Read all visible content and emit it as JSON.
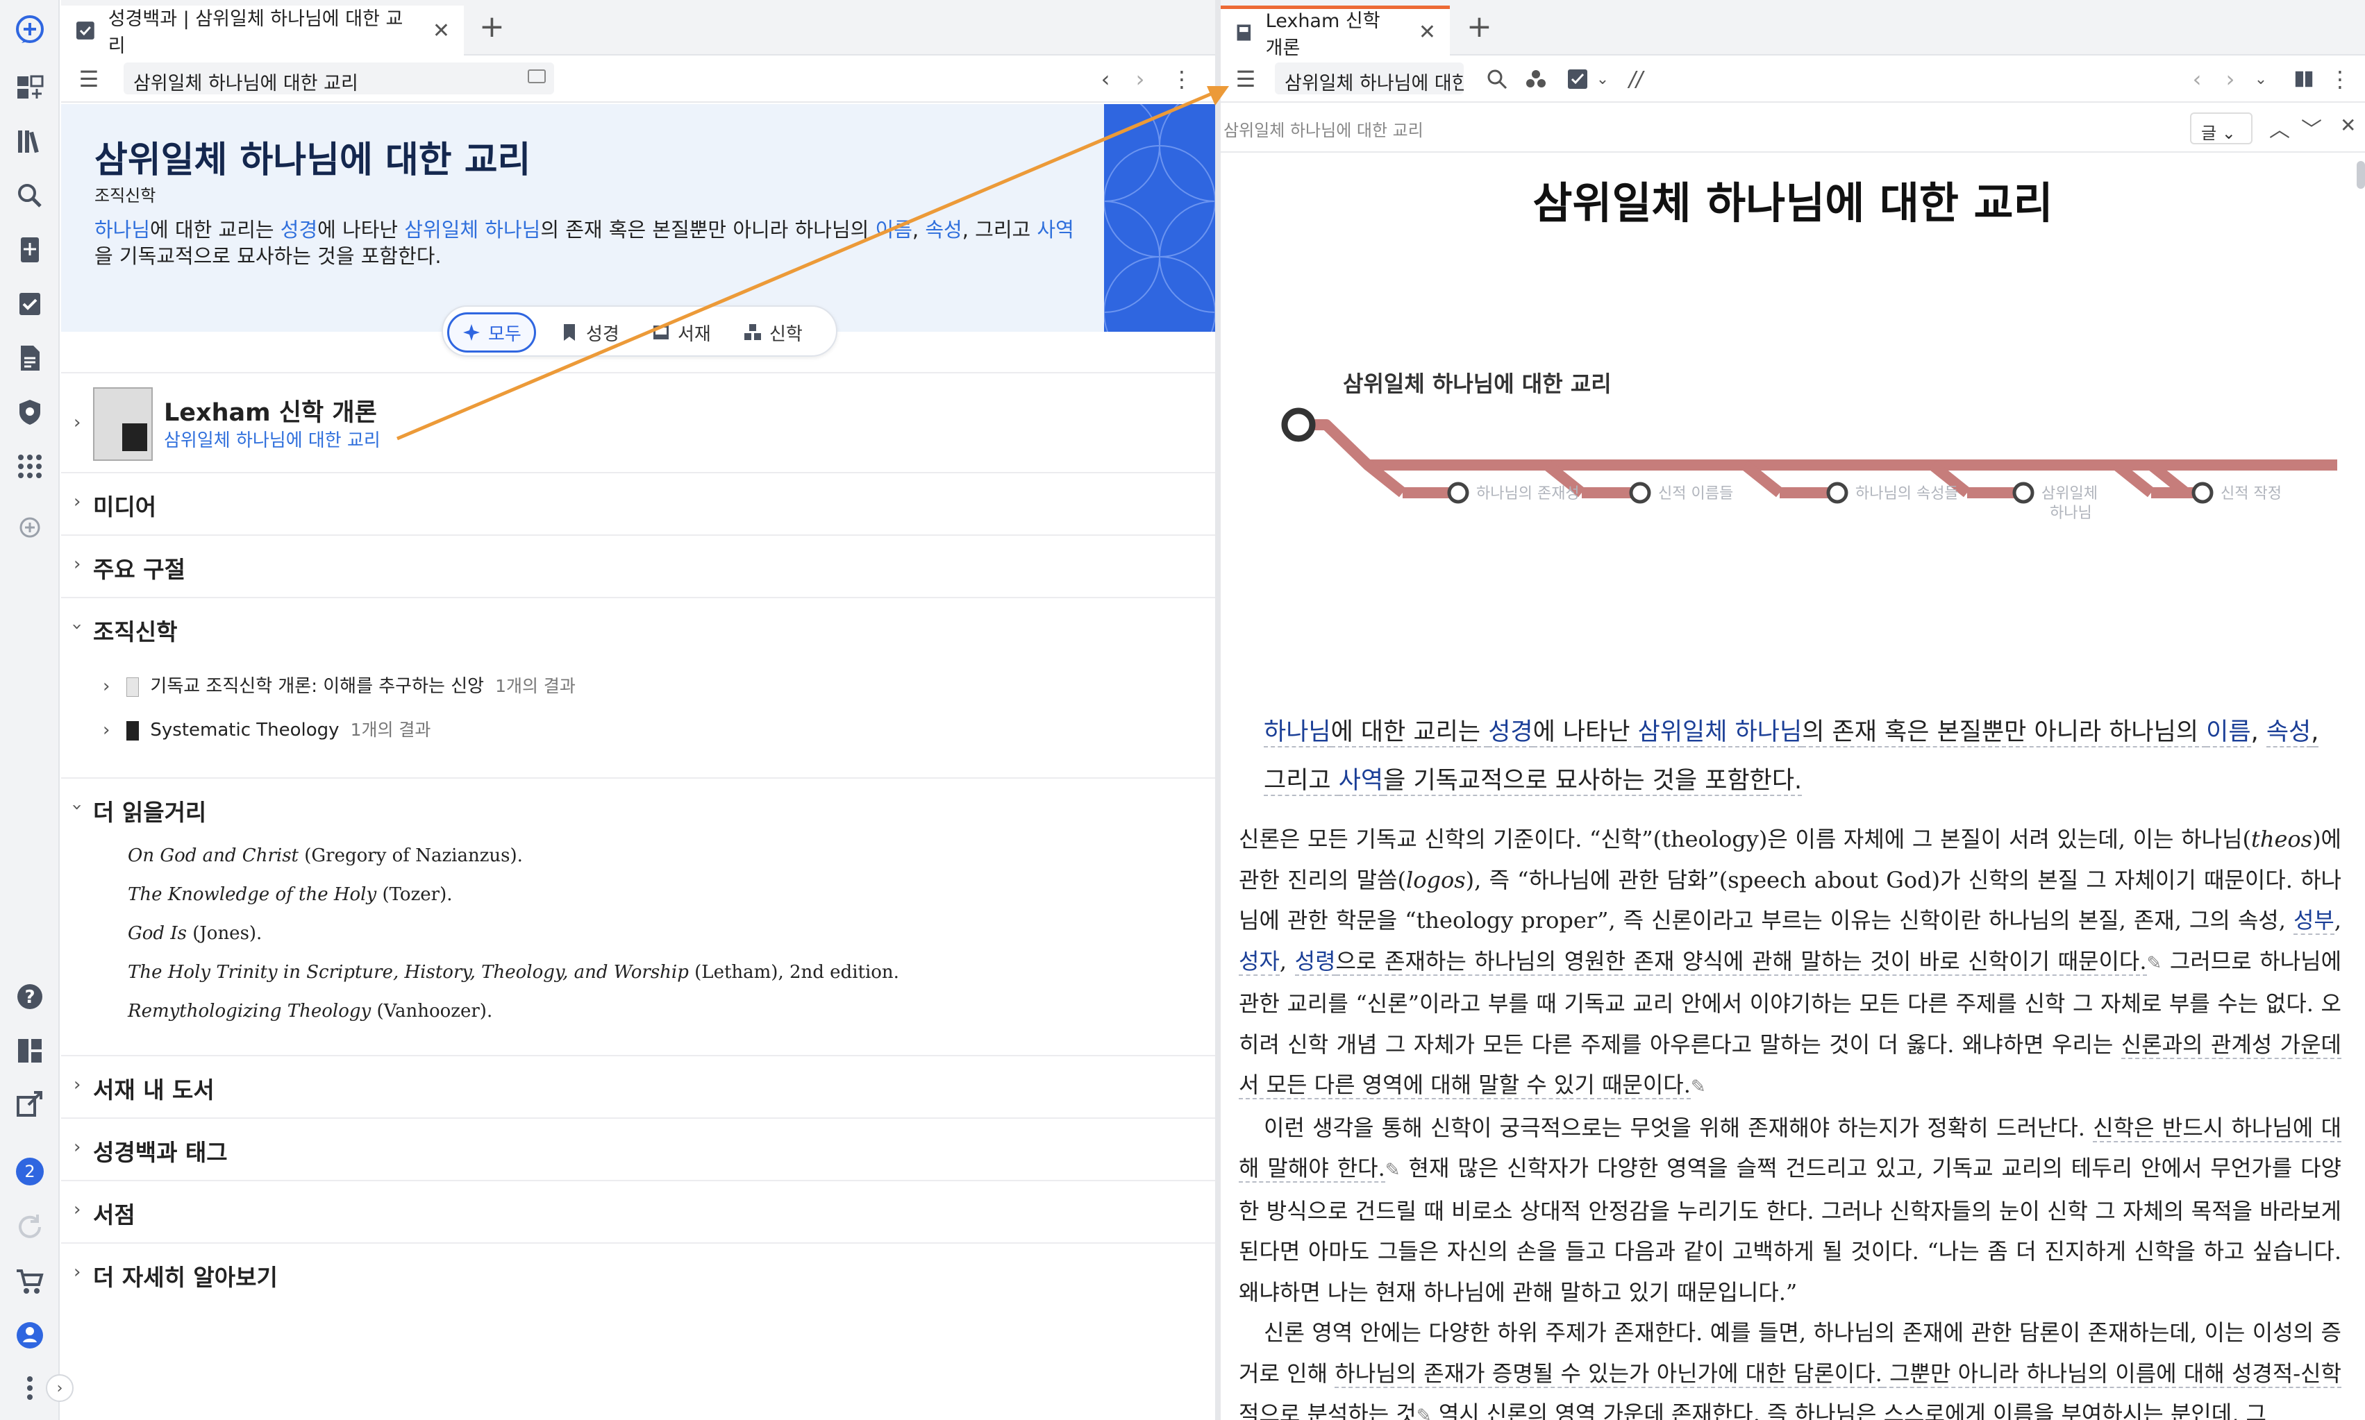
{
  "left_tab": {
    "title": "성경백과 | 삼위일체 하나님에 대한 교리"
  },
  "left_toolbar": {
    "address": "삼위일체 하나님에 대한 교리"
  },
  "article": {
    "title": "삼위일체 하나님에 대한 교리",
    "subtitle": "조직신학",
    "desc_parts": [
      "하나님",
      "에 대한 교리는 ",
      "성경",
      "에 나타난 ",
      "삼위일체 하나님",
      "의 존재 혹은 본질뿐만 아니라 하나님의 ",
      "이름",
      ", ",
      "속성",
      ", 그리고 ",
      "사역",
      "을 기독교적으로 묘사하는 것을 포함한다."
    ]
  },
  "filters": [
    {
      "label": "모두",
      "icon": "sparkle-icon",
      "active": true
    },
    {
      "label": "성경",
      "icon": "bookmark-icon",
      "active": false
    },
    {
      "label": "서재",
      "icon": "library-book-icon",
      "active": false
    },
    {
      "label": "신학",
      "icon": "topics-icon",
      "active": false
    }
  ],
  "featured": {
    "book": "Lexham 신학 개론",
    "link": "삼위일체 하나님에 대한 교리"
  },
  "sections": {
    "media": "미디어",
    "key_passages": "주요 구절",
    "systematic": "조직신학",
    "further": "더 읽을거리",
    "in_library": "서재 내 도서",
    "tags": "성경백과 태그",
    "store": "서점",
    "learn_more": "더 자세히 알아보기"
  },
  "systematic_items": [
    {
      "title": "기독교 조직신학 개론: 이해를 추구하는 신앙",
      "count": "1개의 결과"
    },
    {
      "title": "Systematic Theology",
      "count": "1개의 결과"
    }
  ],
  "reading": [
    {
      "title": "On God and Christ",
      "rest": " (Gregory of Nazianzus)."
    },
    {
      "title": "The Knowledge of the Holy",
      "rest": " (Tozer)."
    },
    {
      "title": "God Is",
      "rest": " (Jones)."
    },
    {
      "title": "The Holy Trinity in Scripture, History, Theology, and Worship",
      "rest": " (Letham), 2nd edition."
    },
    {
      "title": "Remythologizing Theology",
      "rest": " (Vanhoozer)."
    }
  ],
  "rail": {
    "badge_count": "2"
  },
  "right_tab": {
    "title": "Lexham 신학 개론"
  },
  "right_toolbar": {
    "address": "삼위일체 하나님에 대한",
    "slashes": "//",
    "find_breadcrumb": "삼위일체 하나님에 대한 교리",
    "find_scope": "글"
  },
  "right_doc": {
    "title": "삼위일체 하나님에 대한 교리",
    "timeline_root": "삼위일체 하나님에 대한 교리",
    "timeline_stops": [
      "하나님의 존재성",
      "신적 이름들",
      "하나님의 속성들",
      "삼위일체",
      "하나님",
      "신적 작정"
    ],
    "intro_parts": [
      "하나님",
      "에 대한 교리는 ",
      "성경",
      "에 나타난 ",
      "삼위일체 하나님",
      "의 존재 혹은 본질뿐만 아니라 하나님의 ",
      "이름",
      ",",
      "속성",
      ", 그리고 ",
      "사역",
      "을 기독교적으로 묘사하는 것을 포함한다."
    ],
    "p1": [
      "신론은 모든 기독교 신학의 기준이다. “신학”(theology)은 이름 자체에 그 본질이 서려 있는데, 이는 하나님(",
      "theos",
      ")에 관한 진리의 말씀(",
      "logos",
      "), 즉 “하나님에 관한 담화”(speech about God)가 신학의 본질 그 자체이기 때문이다. 하나님에 관한 학문을 “theology proper”, 즉 신론이라고 부르는 이유는 신학이란 하나님의 본질, 존재, 그의 속성, ",
      "성부",
      ", ",
      "성자",
      ", ",
      "성령",
      "으로 존재하는 하나님의 영원한 존재 양식에 관해 말하는 것이 바로 신학이기 때문이다.",
      " 그러므로 하나님에 관한 교리를 “신론”이라고 부를 때 기독교 교리 안에서 이야기하는 모든 다른 주제를 신학 그 자체로 부를 수는 없다. 오히려 신학 개념 그 자체가 모든 다른 주제를 아우른다고 말하는 것이 더 옳다. 왜냐하면 우리는 ",
      "신론과의 관계성 가운데서 모든 다른 영역에 대해 말할 수 있기 때문이다."
    ],
    "p2": [
      "이런 생각을 통해 신학이 궁극적으로는 무엇을 위해 존재해야 하는지가 정확히 드러난다. ",
      "신학은 반드시 하나님에 대해 말해야 한다.",
      " 현재 많은 신학자가 다양한 영역을 슬쩍 건드리고 있고, 기독교 교리의 테두리 안에서 무언가를 다양한 방식으로 건드릴 때 비로소 상대적 안정감을 누리기도 한다. 그러나 신학자들의 눈이 신학 그 자체의 목적을 바라보게 된다면 아마도 그들은 자신의 손을 들고 다음과 같이 고백하게 될 것이다. “나는 좀 더 진지하게 신학을 하고 싶습니다. 왜냐하면 나는 현재 하나님에 관해 말하고 있기 때문입니다.”"
    ],
    "p3": [
      "신론 영역 안에는 다양한 하위 주제가 존재한다. 예를 들면, 하나님의 존재에 관한 담론이 존재하는데, 이는 이성의 증거로 인해 ",
      "하나님의 존재가 증명될 수 있는가 아닌가에 대한 담론이다.",
      " 그뿐만 아니라 하나님의 이름에 대해 성경적-신학적으로 분석하는 것",
      " 역시 신론의 영역 가운데 존재한다. 즉 하나님은 ",
      "스스로에게 이름을 부여하시는 분인데, 그"
    ]
  },
  "colors": {
    "accent": "#2f66e0",
    "timeline": "#c67d7b",
    "arrow": "#ec9a38",
    "banner": "#edf3fb"
  }
}
